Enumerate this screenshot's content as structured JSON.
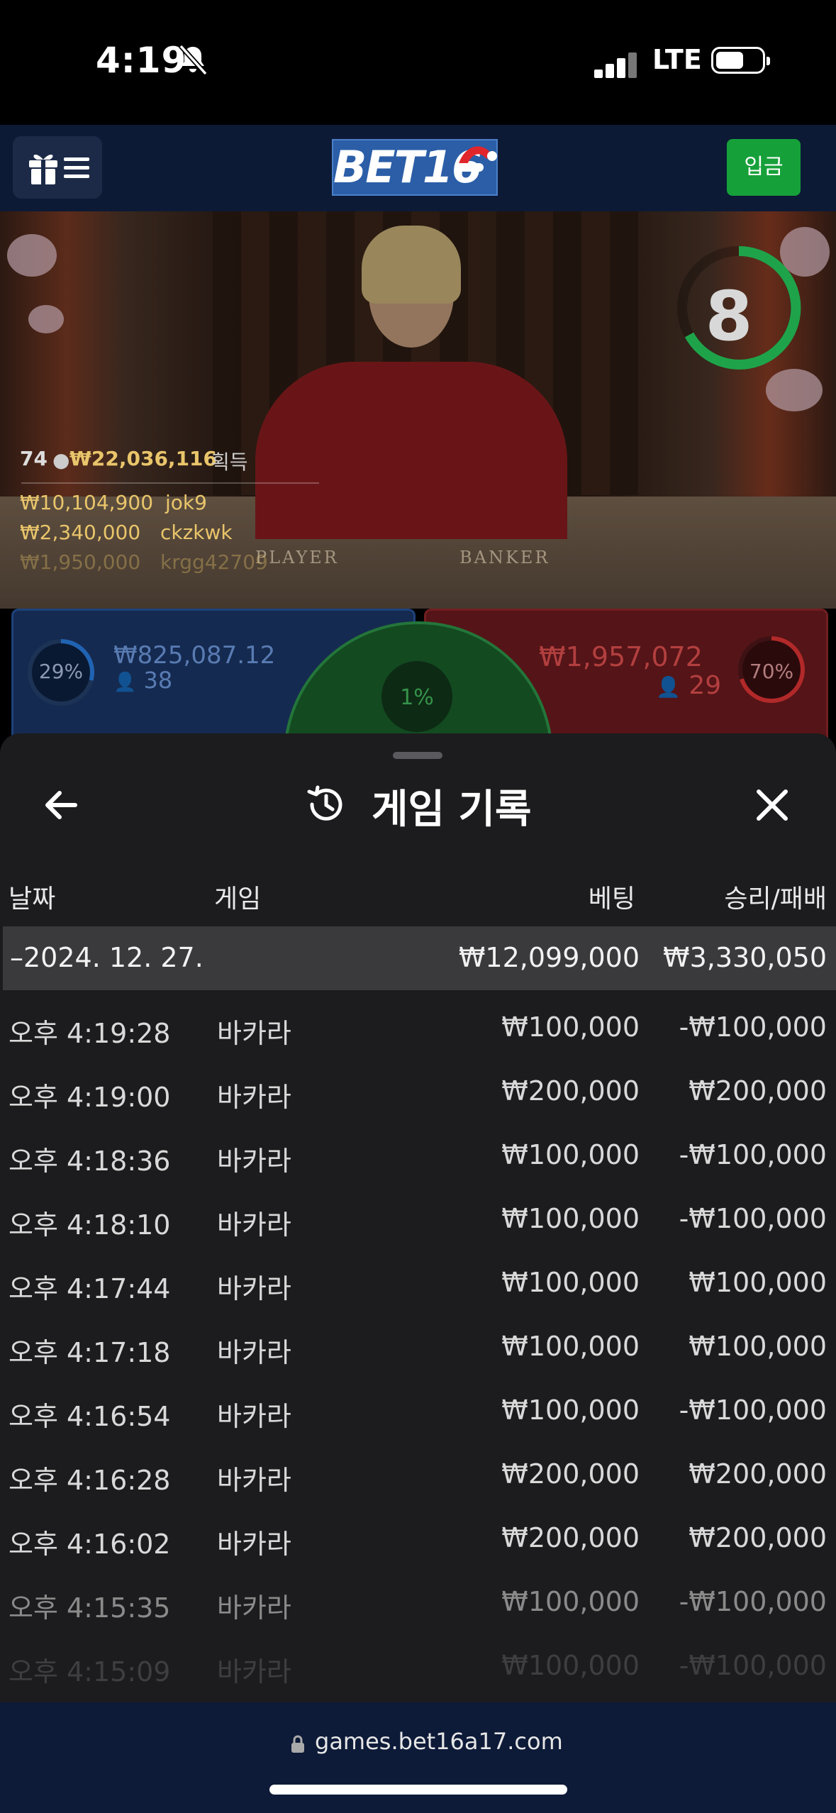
{
  "status_bar": {
    "time": "4:19",
    "network": "LTE"
  },
  "header": {
    "logo_text": "BET16",
    "deposit_label": "입금"
  },
  "live": {
    "timer": "8",
    "winners_count": "74",
    "winners_total": "₩22,036,116",
    "winners_suffix": "획득",
    "winners": [
      {
        "amount": "₩10,104,900",
        "user": "jok9"
      },
      {
        "amount": "₩2,340,000",
        "user": "ckzkwk"
      },
      {
        "amount": "₩1,950,000",
        "user": "krgg42709"
      }
    ],
    "table_labels": {
      "player": "PLAYER",
      "banker": "BANKER"
    }
  },
  "betting": {
    "player": {
      "percent": "29%",
      "percent_value": 0.29,
      "amount": "₩825,087.12",
      "count": "38"
    },
    "tie": {
      "percent": "1%",
      "percent_value": 0.01
    },
    "banker": {
      "percent": "70%",
      "percent_value": 0.7,
      "amount": "₩1,957,072",
      "count": "29"
    },
    "colors": {
      "player": "#1f3d73",
      "banker": "#7a1e22",
      "tie": "#1c6b2f"
    }
  },
  "history": {
    "title": "게임 기록",
    "columns": {
      "date": "날짜",
      "game": "게임",
      "bet": "베팅",
      "result": "승리/패배"
    },
    "group": {
      "date": "–2024. 12. 27.",
      "bet": "₩12,099,000",
      "result": "₩3,330,050"
    },
    "rows": [
      {
        "time": "오후 4:19:28",
        "game": "바카라",
        "bet": "₩100,000",
        "result": "-₩100,000"
      },
      {
        "time": "오후 4:19:00",
        "game": "바카라",
        "bet": "₩200,000",
        "result": "₩200,000"
      },
      {
        "time": "오후 4:18:36",
        "game": "바카라",
        "bet": "₩100,000",
        "result": "-₩100,000"
      },
      {
        "time": "오후 4:18:10",
        "game": "바카라",
        "bet": "₩100,000",
        "result": "-₩100,000"
      },
      {
        "time": "오후 4:17:44",
        "game": "바카라",
        "bet": "₩100,000",
        "result": "₩100,000"
      },
      {
        "time": "오후 4:17:18",
        "game": "바카라",
        "bet": "₩100,000",
        "result": "₩100,000"
      },
      {
        "time": "오후 4:16:54",
        "game": "바카라",
        "bet": "₩100,000",
        "result": "-₩100,000"
      },
      {
        "time": "오후 4:16:28",
        "game": "바카라",
        "bet": "₩200,000",
        "result": "₩200,000"
      },
      {
        "time": "오후 4:16:02",
        "game": "바카라",
        "bet": "₩200,000",
        "result": "₩200,000"
      },
      {
        "time": "오후 4:15:35",
        "game": "바카라",
        "bet": "₩100,000",
        "result": "-₩100,000"
      },
      {
        "time": "오후 4:15:09",
        "game": "바카라",
        "bet": "₩100,000",
        "result": "-₩100,000"
      }
    ]
  },
  "browser": {
    "url": "games.bet16a17.com"
  }
}
